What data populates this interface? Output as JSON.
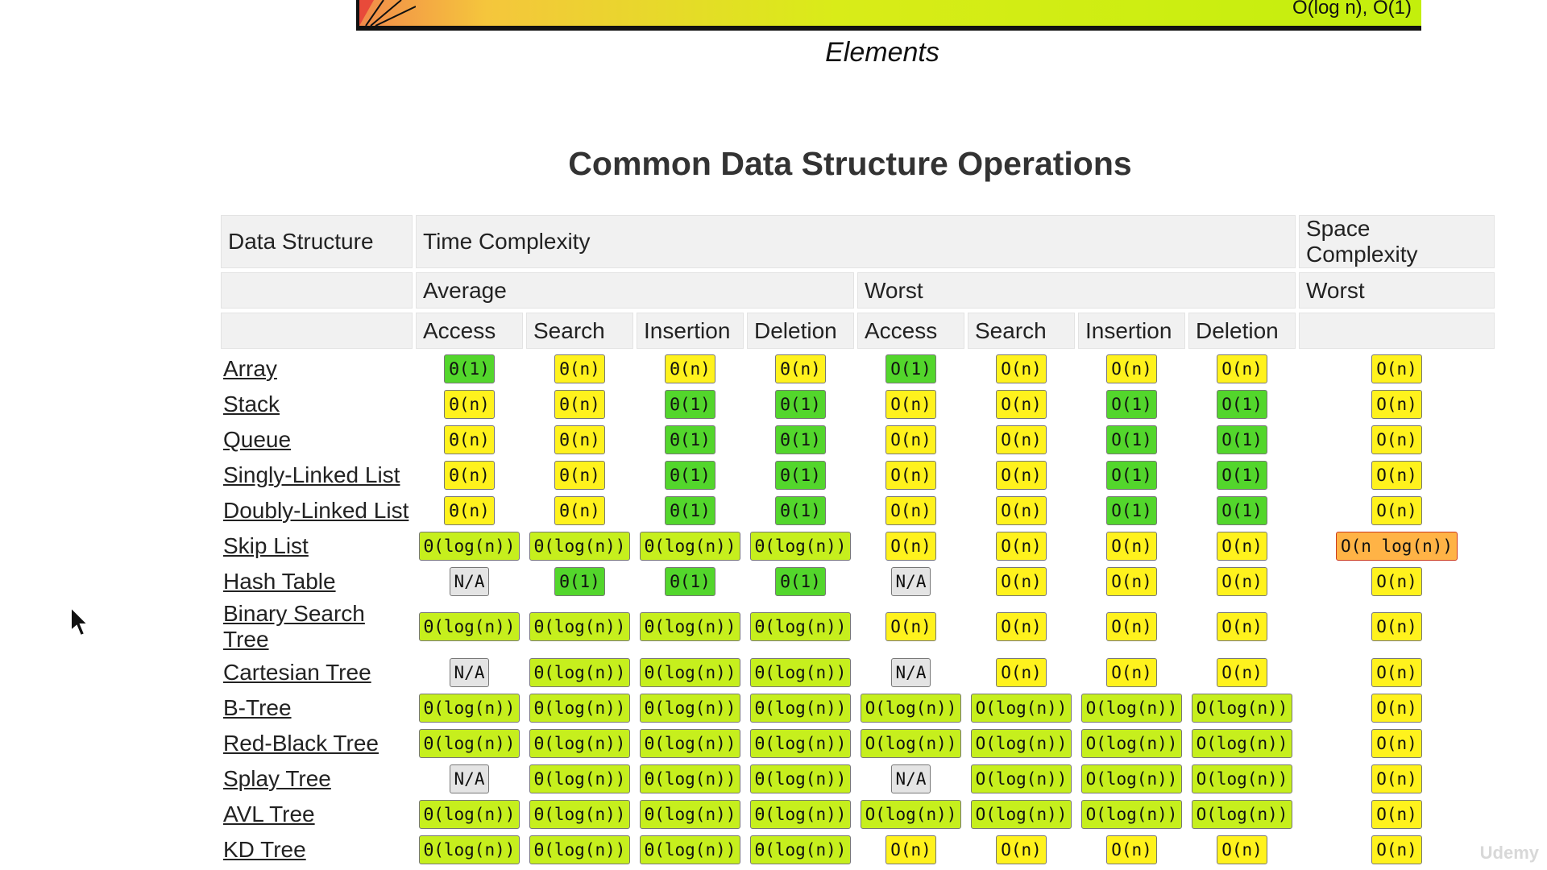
{
  "chart": {
    "corner_label": "O(log n), O(1)",
    "xlabel": "Elements"
  },
  "title": "Common Data Structure Operations",
  "headers": {
    "row1": {
      "ds": "Data Structure",
      "time": "Time Complexity",
      "space": "Space Complexity"
    },
    "row2": {
      "avg": "Average",
      "worst": "Worst",
      "space_worst": "Worst"
    },
    "row3": [
      "Access",
      "Search",
      "Insertion",
      "Deletion",
      "Access",
      "Search",
      "Insertion",
      "Deletion"
    ]
  },
  "rows": [
    {
      "name": "Array",
      "cells": [
        [
          "Θ(1)",
          "green"
        ],
        [
          "Θ(n)",
          "yellow"
        ],
        [
          "Θ(n)",
          "yellow"
        ],
        [
          "Θ(n)",
          "yellow"
        ],
        [
          "O(1)",
          "green"
        ],
        [
          "O(n)",
          "yellow"
        ],
        [
          "O(n)",
          "yellow"
        ],
        [
          "O(n)",
          "yellow"
        ],
        [
          "O(n)",
          "yellow"
        ]
      ]
    },
    {
      "name": "Stack",
      "cells": [
        [
          "Θ(n)",
          "yellow"
        ],
        [
          "Θ(n)",
          "yellow"
        ],
        [
          "Θ(1)",
          "green"
        ],
        [
          "Θ(1)",
          "green"
        ],
        [
          "O(n)",
          "yellow"
        ],
        [
          "O(n)",
          "yellow"
        ],
        [
          "O(1)",
          "green"
        ],
        [
          "O(1)",
          "green"
        ],
        [
          "O(n)",
          "yellow"
        ]
      ]
    },
    {
      "name": "Queue",
      "cells": [
        [
          "Θ(n)",
          "yellow"
        ],
        [
          "Θ(n)",
          "yellow"
        ],
        [
          "Θ(1)",
          "green"
        ],
        [
          "Θ(1)",
          "green"
        ],
        [
          "O(n)",
          "yellow"
        ],
        [
          "O(n)",
          "yellow"
        ],
        [
          "O(1)",
          "green"
        ],
        [
          "O(1)",
          "green"
        ],
        [
          "O(n)",
          "yellow"
        ]
      ]
    },
    {
      "name": "Singly-Linked List",
      "cells": [
        [
          "Θ(n)",
          "yellow"
        ],
        [
          "Θ(n)",
          "yellow"
        ],
        [
          "Θ(1)",
          "green"
        ],
        [
          "Θ(1)",
          "green"
        ],
        [
          "O(n)",
          "yellow"
        ],
        [
          "O(n)",
          "yellow"
        ],
        [
          "O(1)",
          "green"
        ],
        [
          "O(1)",
          "green"
        ],
        [
          "O(n)",
          "yellow"
        ]
      ]
    },
    {
      "name": "Doubly-Linked List",
      "cells": [
        [
          "Θ(n)",
          "yellow"
        ],
        [
          "Θ(n)",
          "yellow"
        ],
        [
          "Θ(1)",
          "green"
        ],
        [
          "Θ(1)",
          "green"
        ],
        [
          "O(n)",
          "yellow"
        ],
        [
          "O(n)",
          "yellow"
        ],
        [
          "O(1)",
          "green"
        ],
        [
          "O(1)",
          "green"
        ],
        [
          "O(n)",
          "yellow"
        ]
      ]
    },
    {
      "name": "Skip List",
      "cells": [
        [
          "Θ(log(n))",
          "lime"
        ],
        [
          "Θ(log(n))",
          "lime"
        ],
        [
          "Θ(log(n))",
          "lime"
        ],
        [
          "Θ(log(n))",
          "lime"
        ],
        [
          "O(n)",
          "yellow"
        ],
        [
          "O(n)",
          "yellow"
        ],
        [
          "O(n)",
          "yellow"
        ],
        [
          "O(n)",
          "yellow"
        ],
        [
          "O(n log(n))",
          "orange"
        ]
      ]
    },
    {
      "name": "Hash Table",
      "cells": [
        [
          "N/A",
          "gray"
        ],
        [
          "Θ(1)",
          "green"
        ],
        [
          "Θ(1)",
          "green"
        ],
        [
          "Θ(1)",
          "green"
        ],
        [
          "N/A",
          "gray"
        ],
        [
          "O(n)",
          "yellow"
        ],
        [
          "O(n)",
          "yellow"
        ],
        [
          "O(n)",
          "yellow"
        ],
        [
          "O(n)",
          "yellow"
        ]
      ]
    },
    {
      "name": "Binary Search Tree",
      "cells": [
        [
          "Θ(log(n))",
          "lime"
        ],
        [
          "Θ(log(n))",
          "lime"
        ],
        [
          "Θ(log(n))",
          "lime"
        ],
        [
          "Θ(log(n))",
          "lime"
        ],
        [
          "O(n)",
          "yellow"
        ],
        [
          "O(n)",
          "yellow"
        ],
        [
          "O(n)",
          "yellow"
        ],
        [
          "O(n)",
          "yellow"
        ],
        [
          "O(n)",
          "yellow"
        ]
      ]
    },
    {
      "name": "Cartesian Tree",
      "cells": [
        [
          "N/A",
          "gray"
        ],
        [
          "Θ(log(n))",
          "lime"
        ],
        [
          "Θ(log(n))",
          "lime"
        ],
        [
          "Θ(log(n))",
          "lime"
        ],
        [
          "N/A",
          "gray"
        ],
        [
          "O(n)",
          "yellow"
        ],
        [
          "O(n)",
          "yellow"
        ],
        [
          "O(n)",
          "yellow"
        ],
        [
          "O(n)",
          "yellow"
        ]
      ]
    },
    {
      "name": "B-Tree",
      "cells": [
        [
          "Θ(log(n))",
          "lime"
        ],
        [
          "Θ(log(n))",
          "lime"
        ],
        [
          "Θ(log(n))",
          "lime"
        ],
        [
          "Θ(log(n))",
          "lime"
        ],
        [
          "O(log(n))",
          "lime"
        ],
        [
          "O(log(n))",
          "lime"
        ],
        [
          "O(log(n))",
          "lime"
        ],
        [
          "O(log(n))",
          "lime"
        ],
        [
          "O(n)",
          "yellow"
        ]
      ]
    },
    {
      "name": "Red-Black Tree",
      "cells": [
        [
          "Θ(log(n))",
          "lime"
        ],
        [
          "Θ(log(n))",
          "lime"
        ],
        [
          "Θ(log(n))",
          "lime"
        ],
        [
          "Θ(log(n))",
          "lime"
        ],
        [
          "O(log(n))",
          "lime"
        ],
        [
          "O(log(n))",
          "lime"
        ],
        [
          "O(log(n))",
          "lime"
        ],
        [
          "O(log(n))",
          "lime"
        ],
        [
          "O(n)",
          "yellow"
        ]
      ]
    },
    {
      "name": "Splay Tree",
      "cells": [
        [
          "N/A",
          "gray"
        ],
        [
          "Θ(log(n))",
          "lime"
        ],
        [
          "Θ(log(n))",
          "lime"
        ],
        [
          "Θ(log(n))",
          "lime"
        ],
        [
          "N/A",
          "gray"
        ],
        [
          "O(log(n))",
          "lime"
        ],
        [
          "O(log(n))",
          "lime"
        ],
        [
          "O(log(n))",
          "lime"
        ],
        [
          "O(n)",
          "yellow"
        ]
      ]
    },
    {
      "name": "AVL Tree",
      "cells": [
        [
          "Θ(log(n))",
          "lime"
        ],
        [
          "Θ(log(n))",
          "lime"
        ],
        [
          "Θ(log(n))",
          "lime"
        ],
        [
          "Θ(log(n))",
          "lime"
        ],
        [
          "O(log(n))",
          "lime"
        ],
        [
          "O(log(n))",
          "lime"
        ],
        [
          "O(log(n))",
          "lime"
        ],
        [
          "O(log(n))",
          "lime"
        ],
        [
          "O(n)",
          "yellow"
        ]
      ]
    },
    {
      "name": "KD Tree",
      "cells": [
        [
          "Θ(log(n))",
          "lime"
        ],
        [
          "Θ(log(n))",
          "lime"
        ],
        [
          "Θ(log(n))",
          "lime"
        ],
        [
          "Θ(log(n))",
          "lime"
        ],
        [
          "O(n)",
          "yellow"
        ],
        [
          "O(n)",
          "yellow"
        ],
        [
          "O(n)",
          "yellow"
        ],
        [
          "O(n)",
          "yellow"
        ],
        [
          "O(n)",
          "yellow"
        ]
      ]
    }
  ],
  "watermark": "Udemy",
  "cursor_icon": "mouse-pointer-icon"
}
